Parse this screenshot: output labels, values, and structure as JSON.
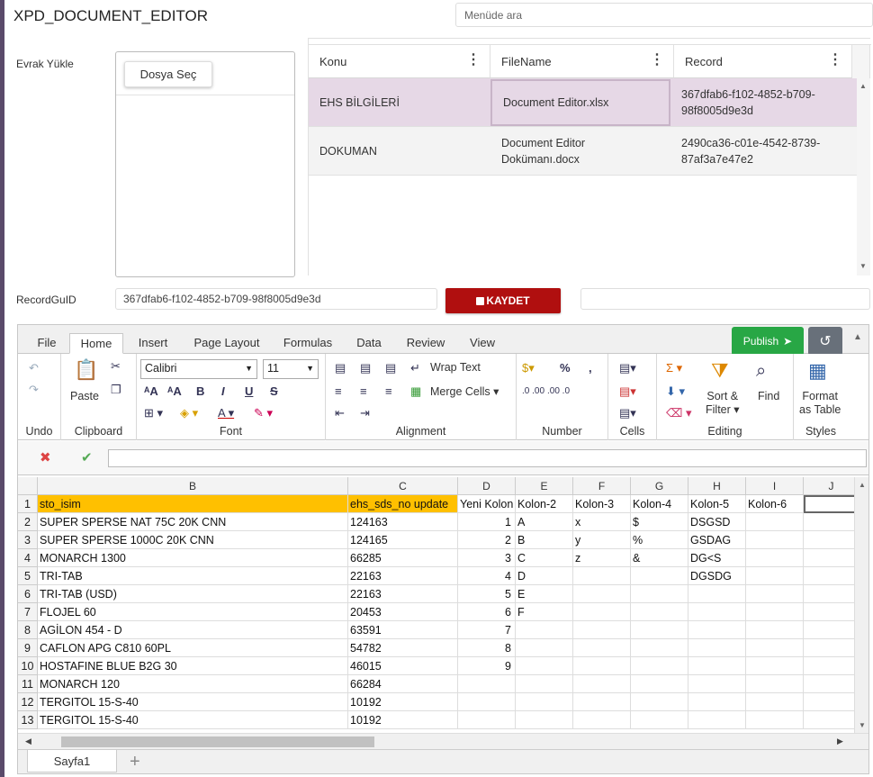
{
  "app": {
    "title": "XPD_DOCUMENT_EDITOR",
    "menu_search_placeholder": "Menüde ara"
  },
  "upload": {
    "label": "Evrak Yükle",
    "choose_button": "Dosya Seç"
  },
  "file_grid": {
    "columns": [
      "Konu",
      "FileName",
      "Record"
    ],
    "rows": [
      {
        "konu": "EHS BİLGİLERİ",
        "filename": "Document Editor.xlsx",
        "record": "367dfab6-f102-4852-b709-98f8005d9e3d",
        "selected": true
      },
      {
        "konu": "DOKUMAN",
        "filename": "Document Editor Dokümanı.docx",
        "record": "2490ca36-c01e-4542-8739-87af3a7e47e2",
        "selected": false
      }
    ]
  },
  "record": {
    "label": "RecordGuID",
    "value": "367dfab6-f102-4852-b709-98f8005d9e3d",
    "save_button": "KAYDET"
  },
  "spreadsheet": {
    "tabs": [
      "File",
      "Home",
      "Insert",
      "Page Layout",
      "Formulas",
      "Data",
      "Review",
      "View"
    ],
    "active_tab": "Home",
    "publish_button": "Publish",
    "ribbon": {
      "groups": [
        "Undo",
        "Clipboard",
        "Font",
        "Alignment",
        "Number",
        "Cells",
        "Editing",
        "Styles"
      ],
      "paste": "Paste",
      "font_name": "Calibri",
      "font_size": "11",
      "wrap_text": "Wrap Text",
      "merge_cells": "Merge Cells",
      "sort_filter_line1": "Sort &",
      "sort_filter_line2": "Filter",
      "find": "Find",
      "format_table_line1": "Format",
      "format_table_line2": "as Table"
    },
    "columns": [
      "B",
      "C",
      "D",
      "E",
      "F",
      "G",
      "H",
      "I",
      "J"
    ],
    "rows": [
      {
        "n": "1",
        "b": "sto_isim",
        "c": "ehs_sds_no update",
        "d": "Yeni Kolon",
        "e": "Kolon-2",
        "f": "Kolon-3",
        "g": "Kolon-4",
        "h": "Kolon-5",
        "i": "Kolon-6"
      },
      {
        "n": "2",
        "b": "SUPER SPERSE NAT 75C 20K CNN",
        "c": "124163",
        "d": "1",
        "e": "A",
        "f": "x",
        "g": "$",
        "h": "DSGSD",
        "i": ""
      },
      {
        "n": "3",
        "b": "SUPER SPERSE 1000C 20K CNN",
        "c": "124165",
        "d": "2",
        "e": "B",
        "f": "y",
        "g": "%",
        "h": "GSDAG",
        "i": ""
      },
      {
        "n": "4",
        "b": "MONARCH 1300",
        "c": "66285",
        "d": "3",
        "e": "C",
        "f": "z",
        "g": "&",
        "h": "DG<S",
        "i": ""
      },
      {
        "n": "5",
        "b": "TRI-TAB",
        "c": "22163",
        "d": "4",
        "e": "D",
        "f": "",
        "g": "",
        "h": "DGSDG",
        "i": ""
      },
      {
        "n": "6",
        "b": "TRI-TAB (USD)",
        "c": "22163",
        "d": "5",
        "e": "E",
        "f": "",
        "g": "",
        "h": "",
        "i": ""
      },
      {
        "n": "7",
        "b": "FLOJEL 60",
        "c": "20453",
        "d": "6",
        "e": "F",
        "f": "",
        "g": "",
        "h": "",
        "i": ""
      },
      {
        "n": "8",
        "b": "AGİLON 454 - D",
        "c": "63591",
        "d": "7",
        "e": "",
        "f": "",
        "g": "",
        "h": "",
        "i": ""
      },
      {
        "n": "9",
        "b": "CAFLON APG C810 60PL",
        "c": "54782",
        "d": "8",
        "e": "",
        "f": "",
        "g": "",
        "h": "",
        "i": ""
      },
      {
        "n": "10",
        "b": "HOSTAFINE BLUE B2G 30",
        "c": "46015",
        "d": "9",
        "e": "",
        "f": "",
        "g": "",
        "h": "",
        "i": ""
      },
      {
        "n": "11",
        "b": "MONARCH 120",
        "c": "66284",
        "d": "",
        "e": "",
        "f": "",
        "g": "",
        "h": "",
        "i": ""
      },
      {
        "n": "12",
        "b": "TERGITOL 15-S-40",
        "c": "10192",
        "d": "",
        "e": "",
        "f": "",
        "g": "",
        "h": "",
        "i": ""
      },
      {
        "n": "13",
        "b": "TERGITOL 15-S-40",
        "c": "10192",
        "d": "",
        "e": "",
        "f": "",
        "g": "",
        "h": "",
        "i": ""
      }
    ],
    "sheet_tab": "Sayfa1"
  },
  "colors": {
    "header_fill": "#ffc000",
    "save_button": "#b00f0f",
    "publish": "#28a745",
    "selected_row": "#e6d8e6"
  }
}
